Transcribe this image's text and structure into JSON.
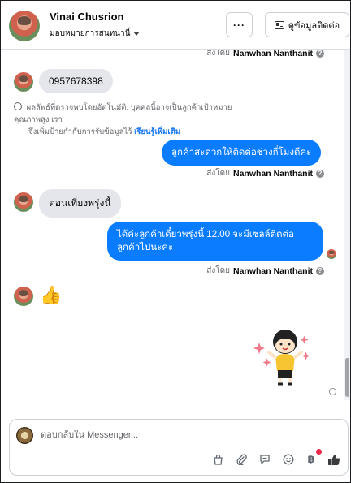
{
  "header": {
    "contact_name": "Vinai Chusrion",
    "assign_label": "มอบหมายการสนทนานี้",
    "more_label": "···",
    "info_button_label": "ดูข้อมูลติดต่อ"
  },
  "messages": [
    {
      "type": "meta",
      "prefix": "ส่งโดย",
      "sender": "Nanwhan Nanthanit"
    },
    {
      "type": "incoming",
      "text": "0957678398"
    },
    {
      "type": "system",
      "line1": "ผลลัพธ์ที่ตรวจพบโดยอัตโนมัติ: บุคคลนี้อาจเป็นลูกค้าเป้าหมายคุณภาพสูง เรา",
      "line2": "จึงเพิ่มป้ายกำกับการรับข้อมูลไว้",
      "link": "เรียนรู้เพิ่มเติม"
    },
    {
      "type": "outgoing",
      "text": "ลูกค้าสะดวกให้ติดต่อช่วงกี่โมงดีคะ"
    },
    {
      "type": "meta",
      "prefix": "ส่งโดย",
      "sender": "Nanwhan Nanthanit"
    },
    {
      "type": "incoming",
      "text": "ตอนเที่ยงพรุ่งนี้"
    },
    {
      "type": "outgoing",
      "line1": "ได้ค่ะลูกค้าเดี๋ยวพรุ่งนี้ 12.00 จะมีเซลล์ติดต่อ",
      "line2": "ลูกค้าไปนะคะ"
    },
    {
      "type": "meta",
      "prefix": "ส่งโดย",
      "sender": "Nanwhan Nanthanit"
    },
    {
      "type": "incoming-emoji",
      "text": "👍"
    },
    {
      "type": "sticker",
      "icon": "girl-sticker"
    }
  ],
  "composer": {
    "placeholder": "ตอบกลับใน Messenger...",
    "icons": [
      "bag-icon",
      "paperclip-icon",
      "saved-reply-icon",
      "emoji-icon",
      "baht-icon",
      "like-icon"
    ]
  },
  "colors": {
    "outgoing_bubble": "#0a7cff",
    "incoming_bubble": "#e4e6eb",
    "link": "#1877f2"
  }
}
